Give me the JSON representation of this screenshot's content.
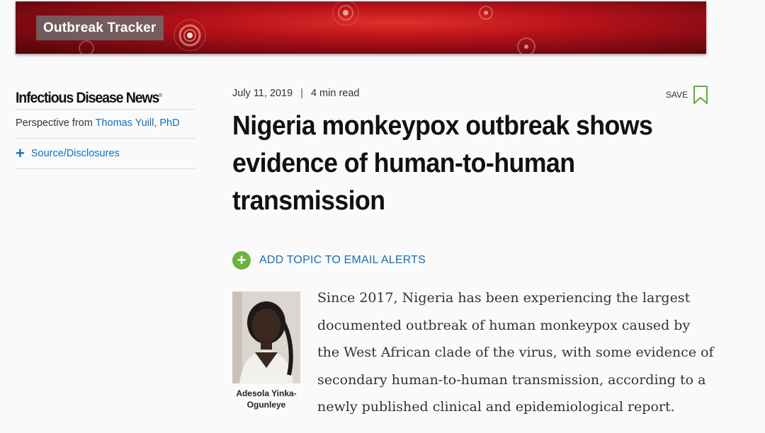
{
  "banner": {
    "label": "Outbreak Tracker"
  },
  "sidebar": {
    "brand": "Infectious Disease News",
    "trademark": "®",
    "perspective_prefix": "Perspective from",
    "perspective_author": "Thomas Yuill, PhD",
    "source_label": "Source/Disclosures"
  },
  "article": {
    "date": "July 11, 2019",
    "separator": "|",
    "read_time": "4 min read",
    "save_label": "SAVE",
    "headline": "Nigeria monkeypox outbreak shows evidence of human-to-human transmission",
    "alerts_label": "ADD TOPIC TO EMAIL ALERTS",
    "photo_caption": "Adesola Yinka-Ogunleye",
    "body": "Since 2017, Nigeria has been experiencing the largest documented outbreak of human monkeypox caused by the West African clade of the virus, with some evidence of secondary human-to-human transmission, according to a newly published clinical and epidemiological report."
  },
  "colors": {
    "link": "#1470b9",
    "banner_red": "#b8121a",
    "alert_green": "#6db33f",
    "save_green": "#5aab3a"
  }
}
